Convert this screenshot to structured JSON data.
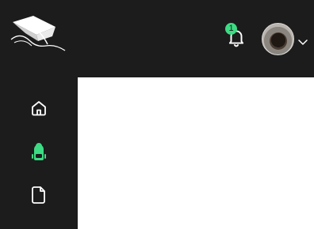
{
  "header": {
    "logo_icon": "graduation-cap-logo",
    "notifications": {
      "icon": "bell-icon",
      "count": "1"
    },
    "user_menu": {
      "avatar": "user-avatar",
      "chevron_icon": "chevron-down-icon"
    }
  },
  "sidebar": {
    "items": [
      {
        "key": "home",
        "icon": "home-icon",
        "active": false
      },
      {
        "key": "courses",
        "icon": "backpack-icon",
        "active": true
      },
      {
        "key": "documents",
        "icon": "document-icon",
        "active": false
      }
    ]
  },
  "colors": {
    "background": "#1c1c1c",
    "accent": "#3ddc84",
    "icon": "#ffffff",
    "content": "#ffffff"
  }
}
